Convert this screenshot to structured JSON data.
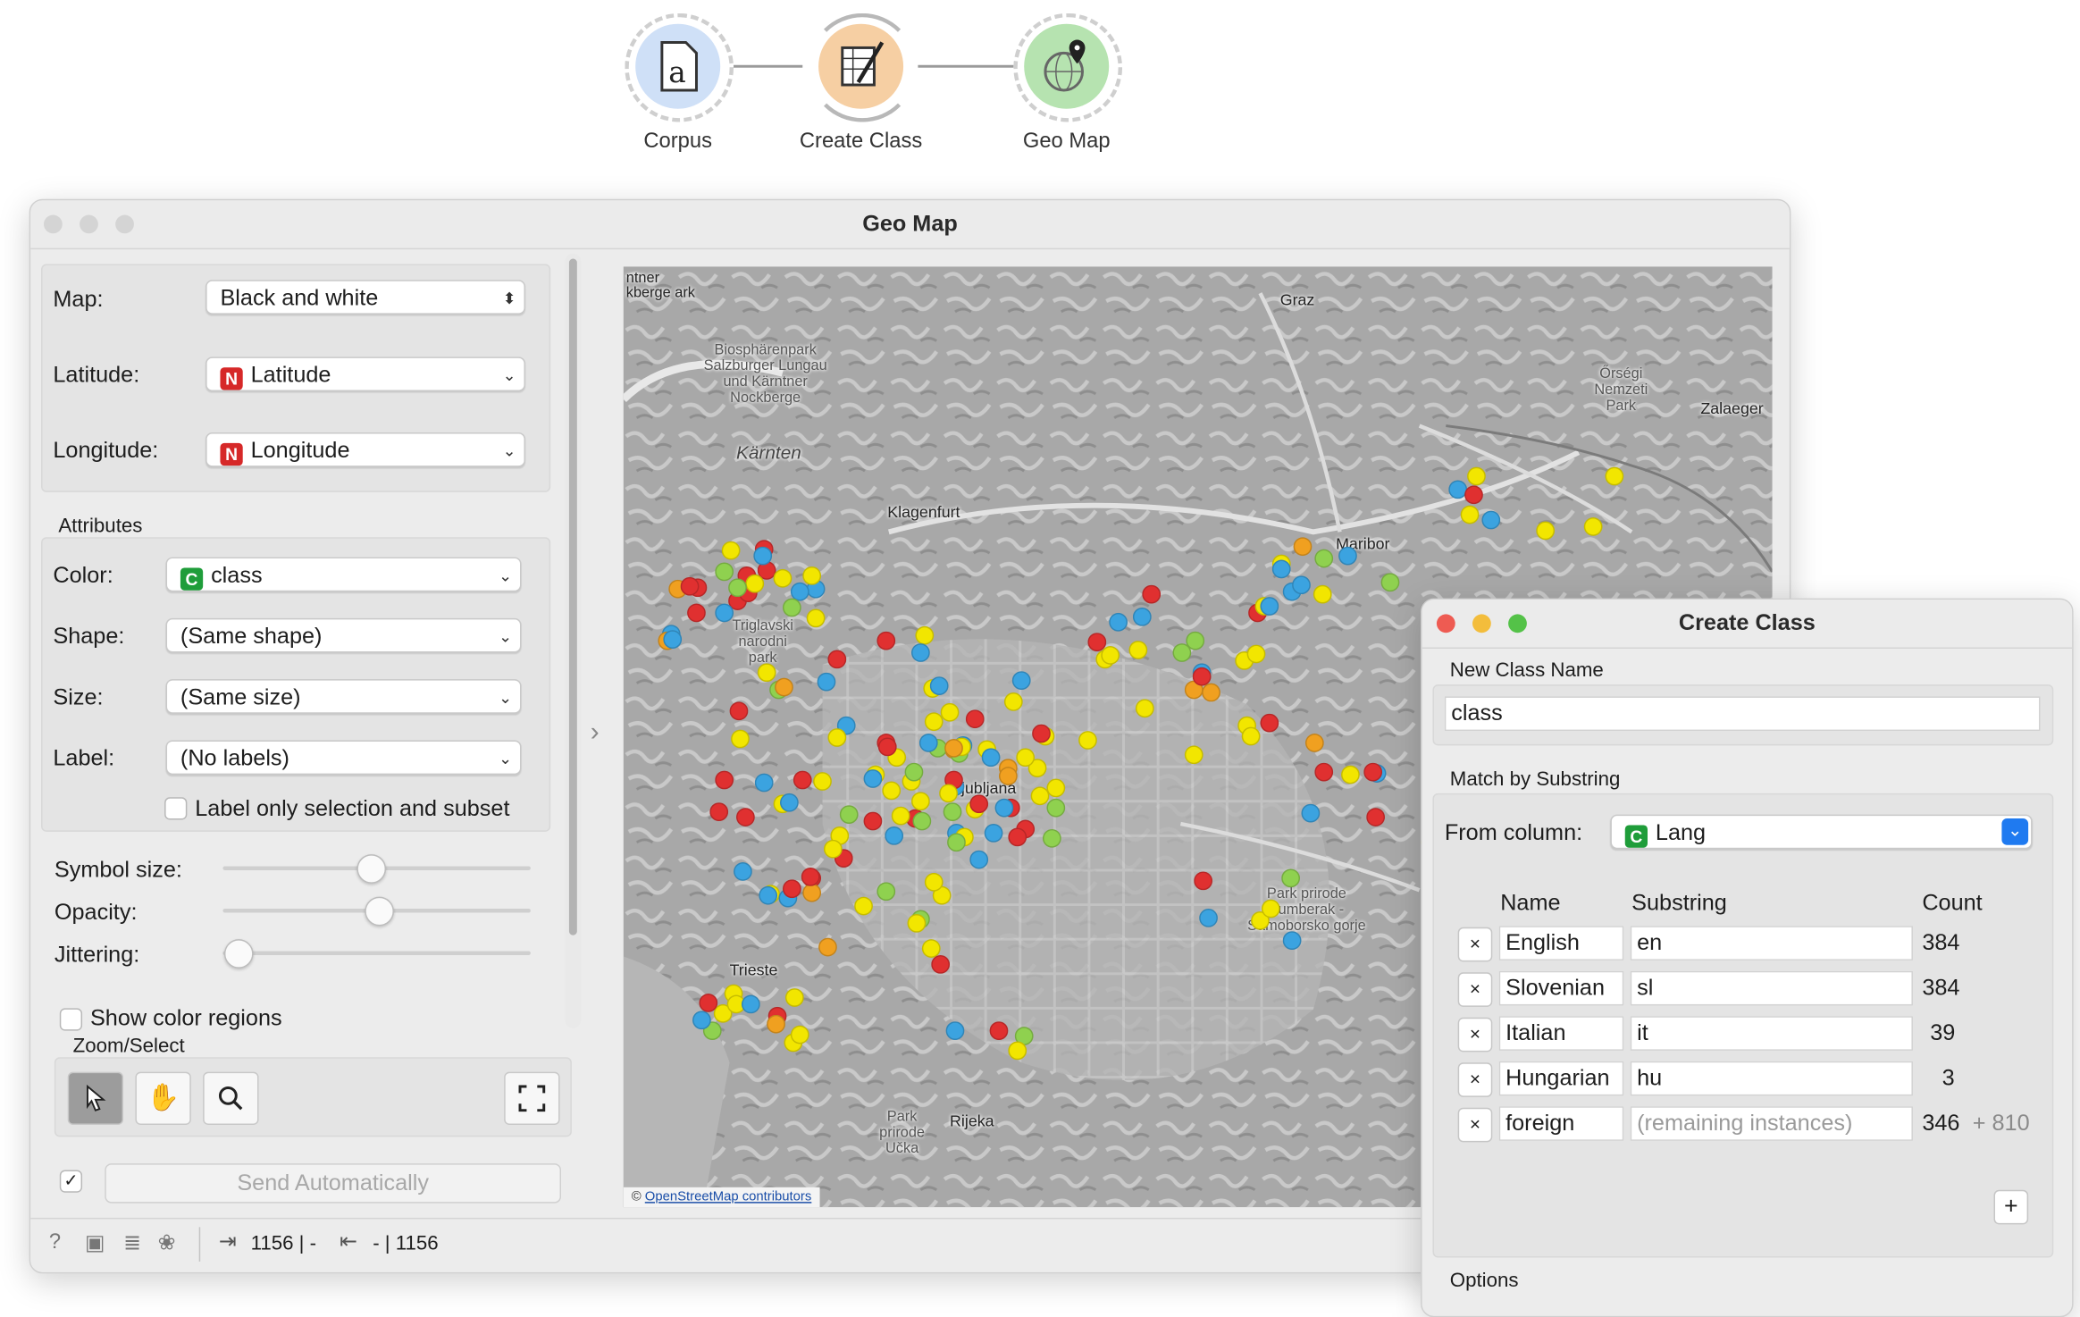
{
  "workflow": {
    "nodes": [
      {
        "label": "Corpus",
        "icon": "document-a-icon",
        "color": "#cfe0f7"
      },
      {
        "label": "Create Class",
        "icon": "table-wand-icon",
        "color": "#f6cfa3"
      },
      {
        "label": "Geo Map",
        "icon": "globe-pin-icon",
        "color": "#b6e3b0"
      }
    ]
  },
  "geomap": {
    "title": "Geo Map",
    "map_label": "Map:",
    "map_value": "Black and white",
    "latitude_label": "Latitude:",
    "latitude_value": "Latitude",
    "latitude_badge": "N",
    "longitude_label": "Longitude:",
    "longitude_value": "Longitude",
    "longitude_badge": "N",
    "attributes_header": "Attributes",
    "color_label": "Color:",
    "color_value": "class",
    "color_badge": "C",
    "shape_label": "Shape:",
    "shape_value": "(Same shape)",
    "size_label": "Size:",
    "size_value": "(Same size)",
    "label_label": "Label:",
    "label_value": "(No labels)",
    "label_only_text": "Label only selection and subset",
    "symbol_size_label": "Symbol size:",
    "symbol_size_level": 0.5,
    "opacity_label": "Opacity:",
    "opacity_level": 0.5,
    "jittering_label": "Jittering:",
    "jittering_level": 0.0,
    "show_regions_text": "Show color regions",
    "zoom_header": "Zoom/Select",
    "send_button": "Send Automatically",
    "status_in": "1156 | -",
    "status_out": "- | 1156",
    "attribution": "© OpenStreetMap contributors",
    "attribution_link": "OpenStreetMap contributors",
    "place_labels": {
      "graz": "Graz",
      "biosphaeren": "Biosphärenpark Salzburger Lungau und Kärntner Nockberge",
      "kaernten": "Kärnten",
      "klagenfurt": "Klagenfurt",
      "orseg": "Őrségi Nemzeti Park",
      "zalaeg": "Zalaeger",
      "maribor": "Maribor",
      "triglav": "Triglavski narodni park",
      "ljubljana": "Ljubljana",
      "trieste": "Trieste",
      "zumberak": "Park prirode Žumberak - Samoborsko gorje",
      "ucka": "Park prirode Učka",
      "rijeka": "Rijeka",
      "edge_top": "ntner kberge ark"
    }
  },
  "createclass": {
    "title": "Create Class",
    "new_class_header": "New Class Name",
    "class_name": "class",
    "match_header": "Match by Substring",
    "from_column_label": "From column:",
    "from_column_value": "Lang",
    "from_column_badge": "C",
    "columns": {
      "name": "Name",
      "substring": "Substring",
      "count": "Count"
    },
    "rows": [
      {
        "name": "English",
        "substring": "en",
        "count": "384",
        "extra": ""
      },
      {
        "name": "Slovenian",
        "substring": "sl",
        "count": "384",
        "extra": ""
      },
      {
        "name": "Italian",
        "substring": "it",
        "count": "39",
        "extra": ""
      },
      {
        "name": "Hungarian",
        "substring": "hu",
        "count": "3",
        "extra": ""
      },
      {
        "name": "foreign",
        "substring": "(remaining instances)",
        "count": "346",
        "extra": "+ 810"
      }
    ],
    "remove_symbol": "×",
    "add_symbol": "+",
    "options_header": "Options"
  },
  "colors": {
    "red": "#e03030",
    "yellow": "#f2e600",
    "blue": "#3ba3e0",
    "green": "#8fd14f",
    "orange": "#f0a020"
  }
}
